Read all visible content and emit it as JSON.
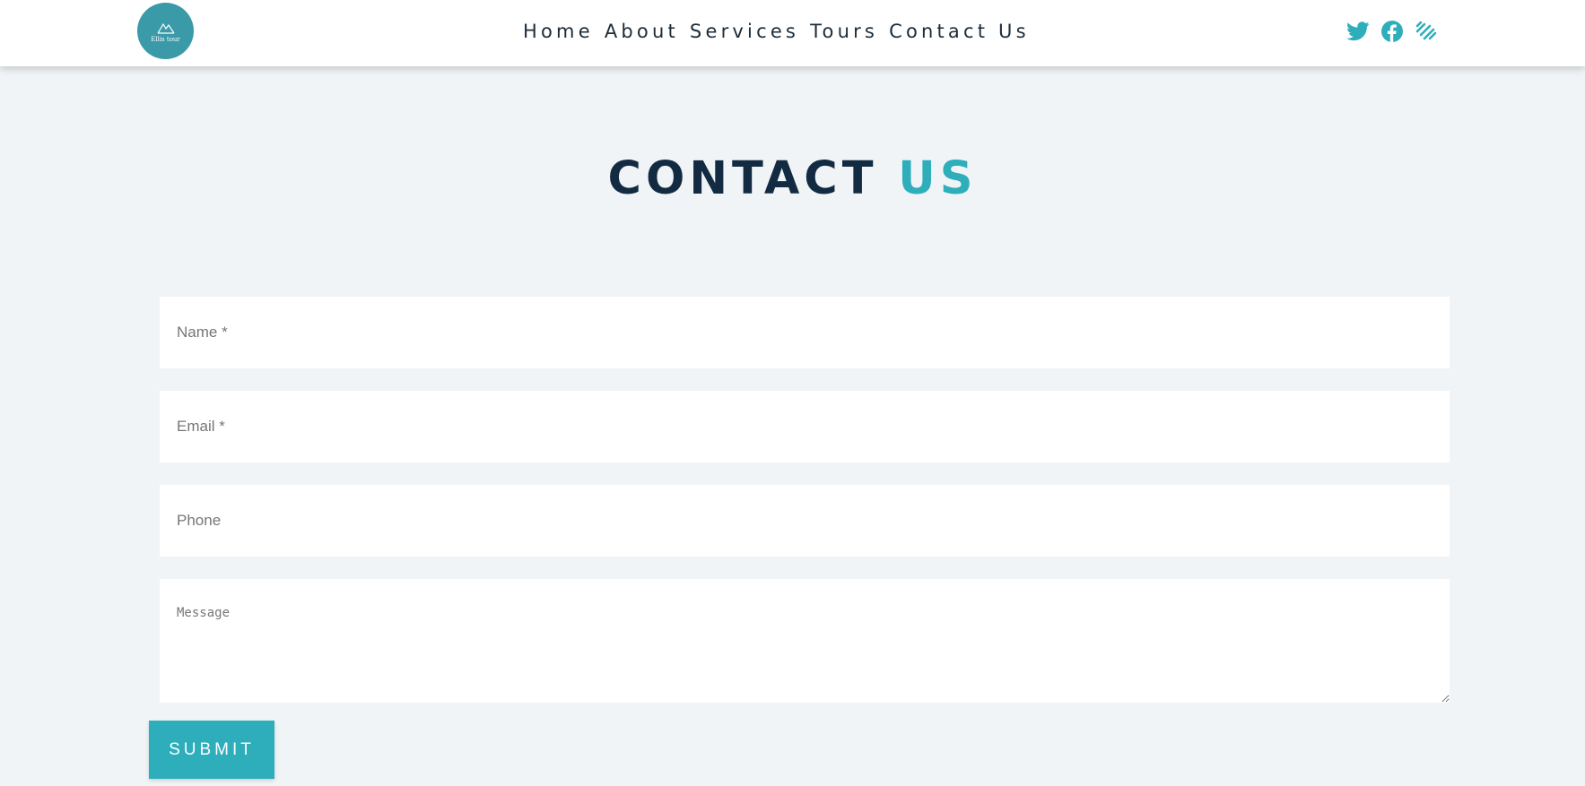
{
  "brand": {
    "logo_text": "Ellis tour"
  },
  "nav": [
    "Home",
    "About",
    "Services",
    "Tours",
    "Contact Us"
  ],
  "social": [
    "twitter-icon",
    "facebook-icon",
    "squarespace-icon"
  ],
  "heading": {
    "part1": "CONTACT",
    "part2": "US"
  },
  "form": {
    "name_placeholder": "Name *",
    "email_placeholder": "Email *",
    "phone_placeholder": "Phone",
    "message_placeholder": "Message",
    "submit_label": "SUBMIT"
  },
  "colors": {
    "accent": "#2eaebb",
    "dark": "#132b42",
    "background": "#f0f4f7",
    "logo": "#3a9aa8"
  }
}
